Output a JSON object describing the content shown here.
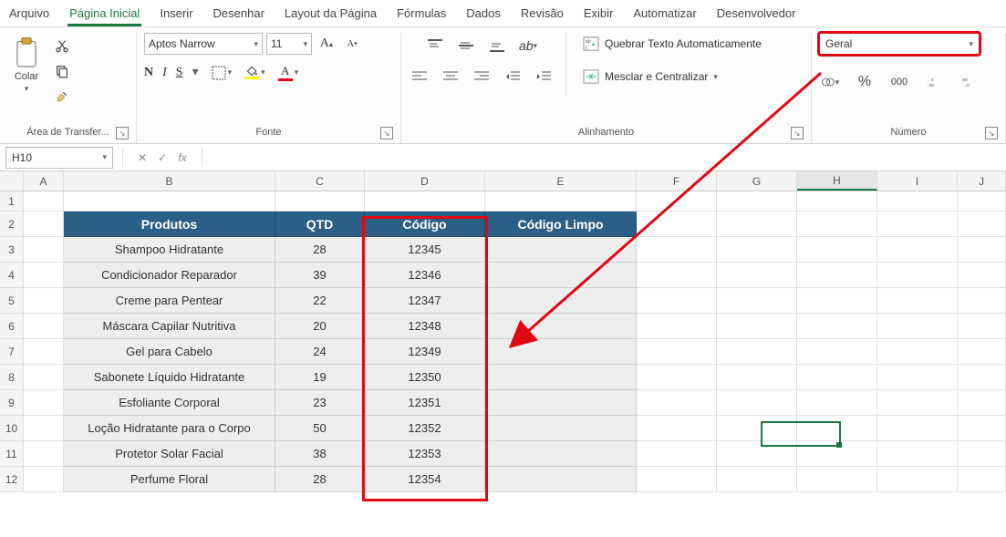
{
  "tabs": {
    "arquivo": "Arquivo",
    "pagina_inicial": "Página Inicial",
    "inserir": "Inserir",
    "desenhar": "Desenhar",
    "layout": "Layout da Página",
    "formulas": "Fórmulas",
    "dados": "Dados",
    "revisao": "Revisão",
    "exibir": "Exibir",
    "automatizar": "Automatizar",
    "desenvolvedor": "Desenvolvedor"
  },
  "clipboard": {
    "colar": "Colar",
    "group": "Área de Transfer..."
  },
  "font": {
    "name": "Aptos Narrow",
    "size": "11",
    "bold": "N",
    "italic": "I",
    "underline": "S",
    "group": "Fonte"
  },
  "align": {
    "wrap": "Quebrar Texto Automaticamente",
    "merge": "Mesclar e Centralizar",
    "group": "Alinhamento"
  },
  "number": {
    "format": "Geral",
    "percent": "%",
    "thousand": "000",
    "inc": "←0\n.00",
    "dec": ".00\n→0",
    "group": "Número"
  },
  "formula_bar": {
    "name_box": "H10",
    "fx": "fx"
  },
  "cols": [
    "",
    "A",
    "B",
    "C",
    "D",
    "E",
    "F",
    "G",
    "H",
    "I",
    "J"
  ],
  "rows": [
    "1",
    "2",
    "3",
    "4",
    "5",
    "6",
    "7",
    "8",
    "9",
    "10",
    "11",
    "12"
  ],
  "table": {
    "headers": {
      "b": "Produtos",
      "c": "QTD",
      "d": "Código",
      "e": "Código Limpo"
    },
    "data": [
      {
        "b": "Shampoo Hidratante",
        "c": "28",
        "d": "12345"
      },
      {
        "b": "Condicionador Reparador",
        "c": "39",
        "d": "12346"
      },
      {
        "b": "Creme para Pentear",
        "c": "22",
        "d": "12347"
      },
      {
        "b": "Máscara Capilar Nutritiva",
        "c": "20",
        "d": "12348"
      },
      {
        "b": "Gel para Cabelo",
        "c": "24",
        "d": "12349"
      },
      {
        "b": "Sabonete Líquido Hidratante",
        "c": "19",
        "d": "12350"
      },
      {
        "b": "Esfoliante Corporal",
        "c": "23",
        "d": "12351"
      },
      {
        "b": "Loção Hidratante para o Corpo",
        "c": "50",
        "d": "12352"
      },
      {
        "b": "Protetor Solar Facial",
        "c": "38",
        "d": "12353"
      },
      {
        "b": "Perfume Floral",
        "c": "28",
        "d": "12354"
      }
    ]
  },
  "annotation": {
    "arrow_color": "#e30613"
  }
}
